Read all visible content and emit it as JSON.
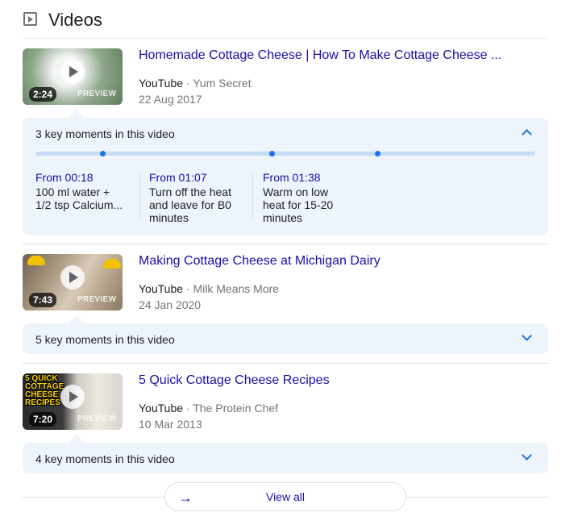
{
  "header": {
    "title": "Videos",
    "icon": "video-play-icon"
  },
  "videos": [
    {
      "title": "Homemade Cottage Cheese | How To Make Cottage Cheese ...",
      "platform": "YouTube",
      "channel": "Yum Secret",
      "date": "22 Aug 2017",
      "duration": "2:24",
      "preview": "PREVIEW",
      "thumb_colors": [
        "#6f8f6b",
        "#cfd8cf",
        "#eef1ee"
      ],
      "key_moments": {
        "label": "3 key moments in this video",
        "expanded": true,
        "moments": [
          {
            "from": "From 00:18",
            "desc": "100 ml water + 1/2 tsp Calcium..."
          },
          {
            "from": "From 01:07",
            "desc": "Turn off the heat and leave for B0 minutes"
          },
          {
            "from": "From 01:38",
            "desc": "Warm on low heat for 15-20 minutes"
          }
        ]
      }
    },
    {
      "title": "Making Cottage Cheese at Michigan Dairy",
      "platform": "YouTube",
      "channel": "Milk Means More",
      "date": "24 Jan 2020",
      "duration": "7:43",
      "preview": "PREVIEW",
      "thumb_colors": [
        "#8a7760",
        "#d8c9b6",
        "#f2c200"
      ],
      "key_moments": {
        "label": "5 key moments in this video",
        "expanded": false
      }
    },
    {
      "title": "5 Quick Cottage Cheese Recipes",
      "platform": "YouTube",
      "channel": "The Protein Chef",
      "date": "10 Mar 2013",
      "duration": "7:20",
      "preview": "PREVIEW",
      "thumb_text": "5 QUICK COTTAGE CHEESE RECIPES",
      "thumb_colors": [
        "#2b2b2b",
        "#e7e4dc",
        "#ffd400"
      ],
      "key_moments": {
        "label": "4 key moments in this video",
        "expanded": false
      }
    }
  ],
  "view_all": {
    "label": "View all"
  },
  "colors": {
    "link": "#1a0dab",
    "accent": "#1a73e8",
    "panel": "#eef4fc",
    "muted": "#70757a"
  }
}
